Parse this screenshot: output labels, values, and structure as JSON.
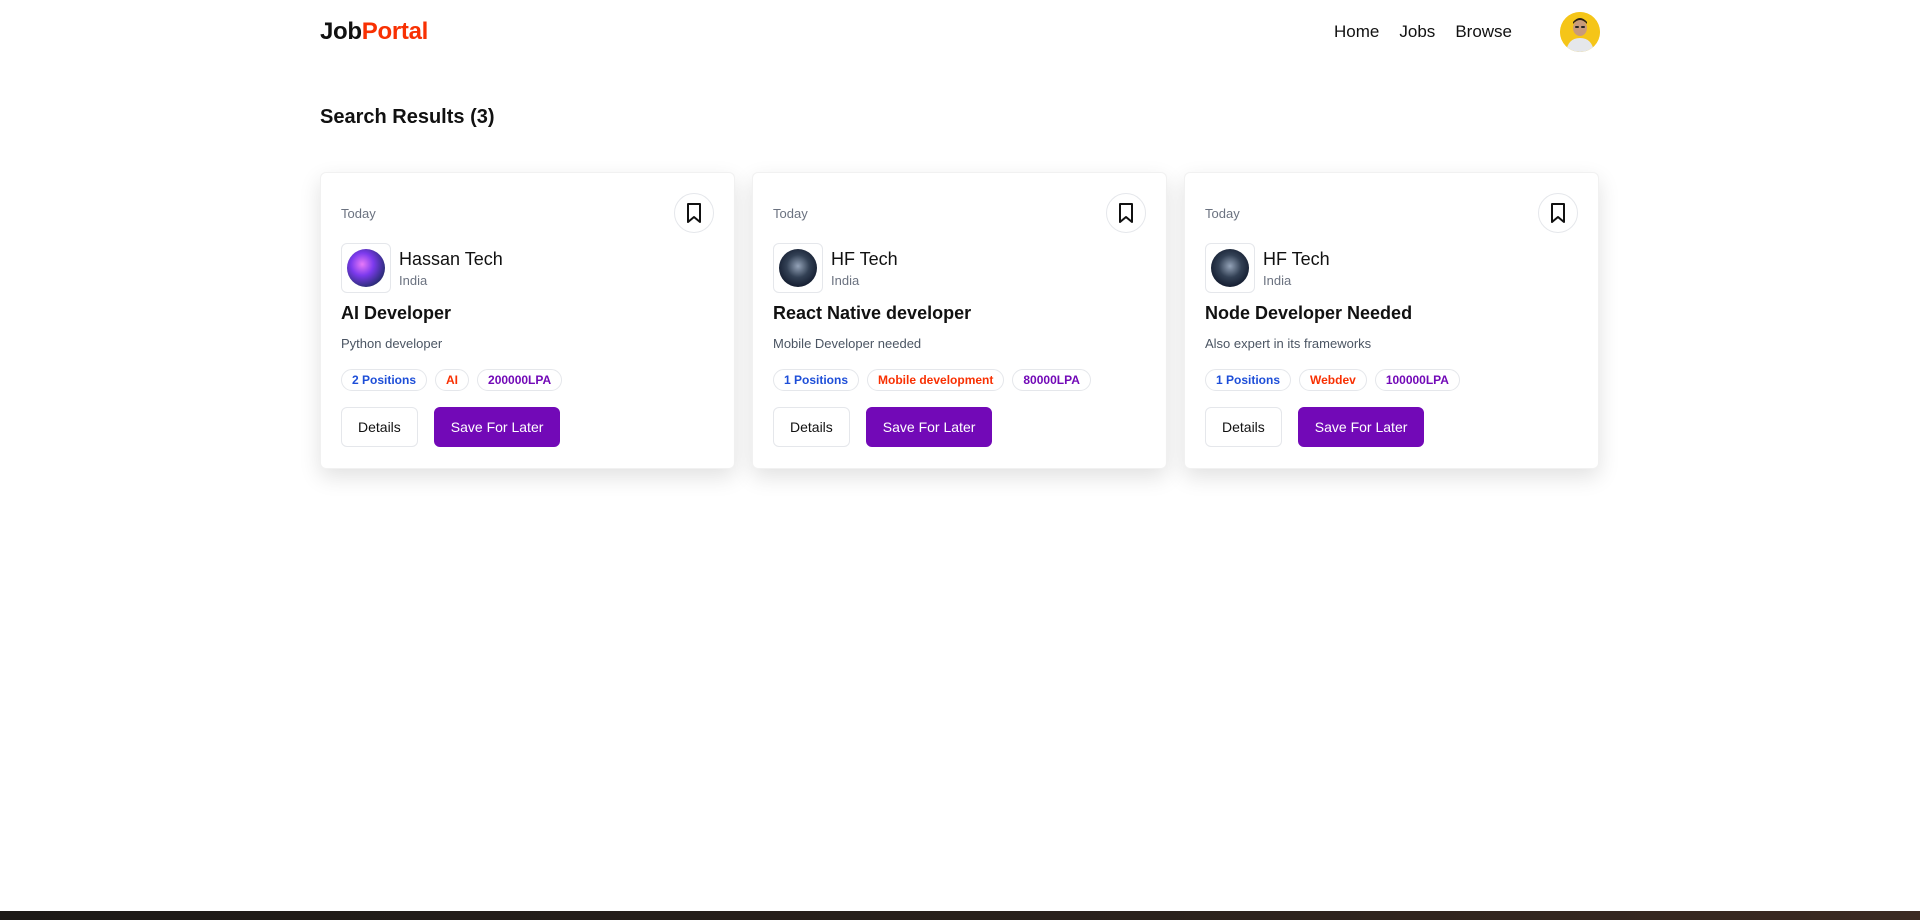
{
  "navbar": {
    "logo_prefix": "Job",
    "logo_accent": "Portal",
    "links": [
      "Home",
      "Jobs",
      "Browse"
    ]
  },
  "results": {
    "title": "Search Results (3)"
  },
  "jobs": [
    {
      "posted": "Today",
      "company": "Hassan Tech",
      "location": "India",
      "title": "AI Developer",
      "description": "Python developer",
      "positions": "2 Positions",
      "job_type": "AI",
      "salary": "200000LPA",
      "details_label": "Details",
      "save_label": "Save For Later"
    },
    {
      "posted": "Today",
      "company": "HF Tech",
      "location": "India",
      "title": "React Native developer",
      "description": "Mobile Developer needed",
      "positions": "1 Positions",
      "job_type": "Mobile development",
      "salary": "80000LPA",
      "details_label": "Details",
      "save_label": "Save For Later"
    },
    {
      "posted": "Today",
      "company": "HF Tech",
      "location": "India",
      "title": "Node Developer Needed",
      "description": "Also expert in its frameworks",
      "positions": "1 Positions",
      "job_type": "Webdev",
      "salary": "100000LPA",
      "details_label": "Details",
      "save_label": "Save For Later"
    }
  ],
  "colors": {
    "brand_accent": "#F83002",
    "primary_button": "#7209b7",
    "badge_blue": "#1d4ed8",
    "badge_red": "#F83002",
    "badge_purple": "#7209b7"
  },
  "icons": {
    "bookmark": "bookmark-icon",
    "avatar": "user-avatar"
  }
}
